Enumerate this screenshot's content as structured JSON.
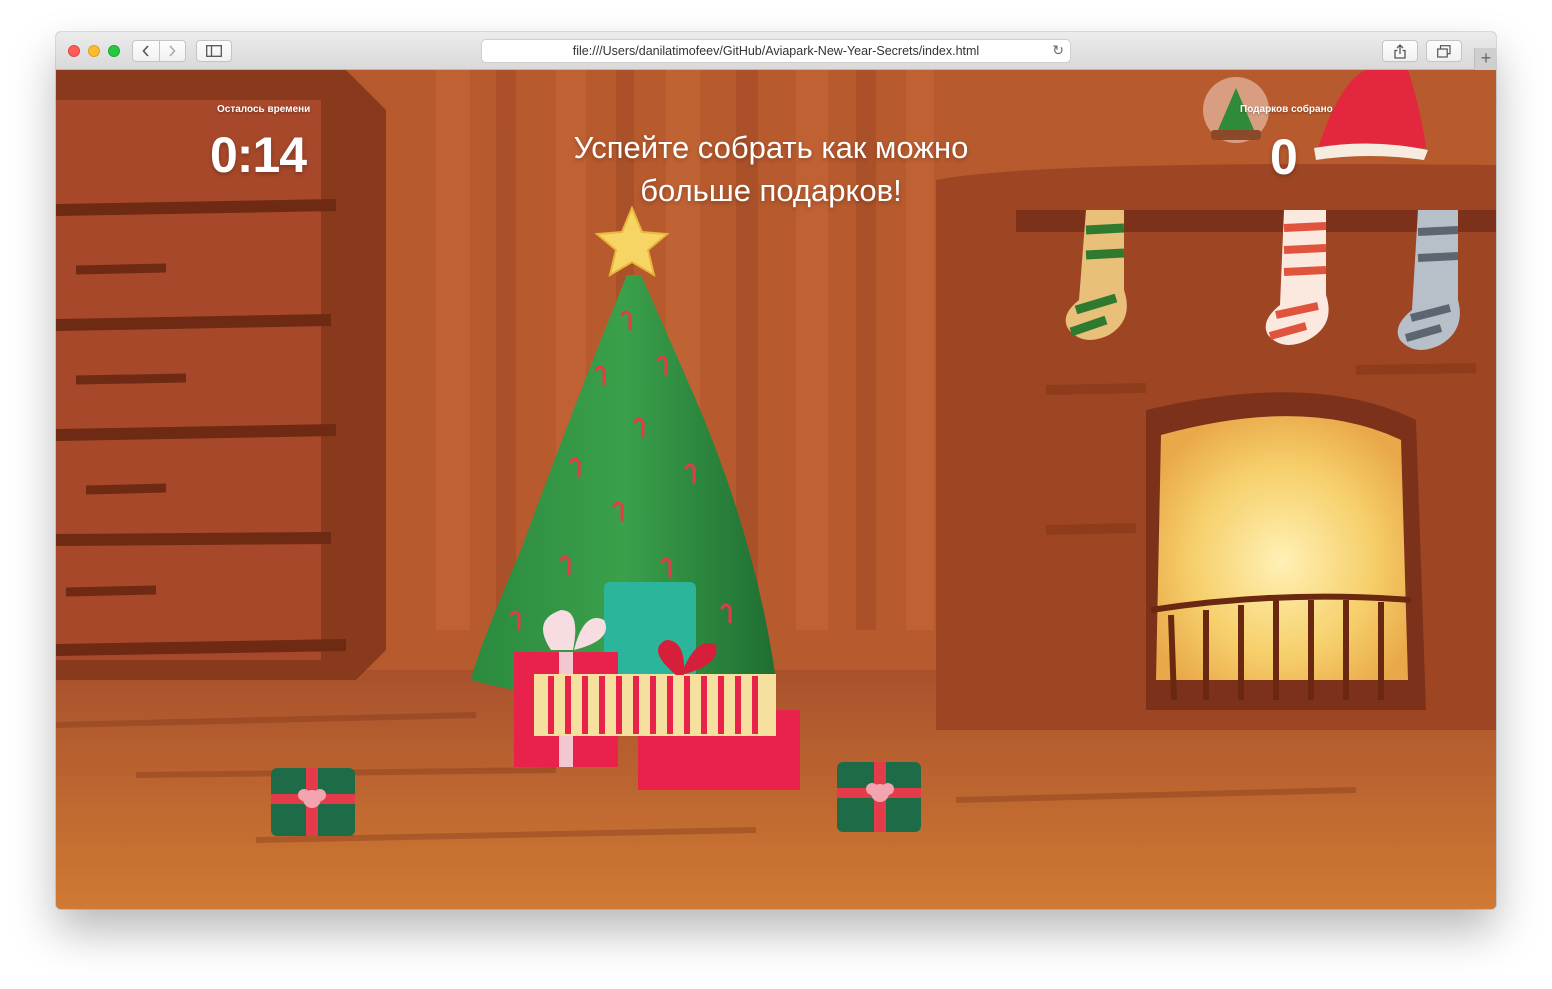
{
  "browser": {
    "url": "file:///Users/danilatimofeev/GitHub/Aviapark-New-Year-Secrets/index.html",
    "new_tab_label": "+"
  },
  "game": {
    "timer_label": "Осталось времени",
    "timer_value": "0:14",
    "instruction_line1": "Успейте собрать как можно",
    "instruction_line2": "больше подарков!",
    "gifts_label": "Подарков собрано",
    "gifts_value": "0"
  },
  "colors": {
    "background": "#b75a2e",
    "tree": "#2e8a3e",
    "star": "#f7d565",
    "gift_green": "#1e6b48",
    "gift_ribbon": "#e33b4a"
  }
}
